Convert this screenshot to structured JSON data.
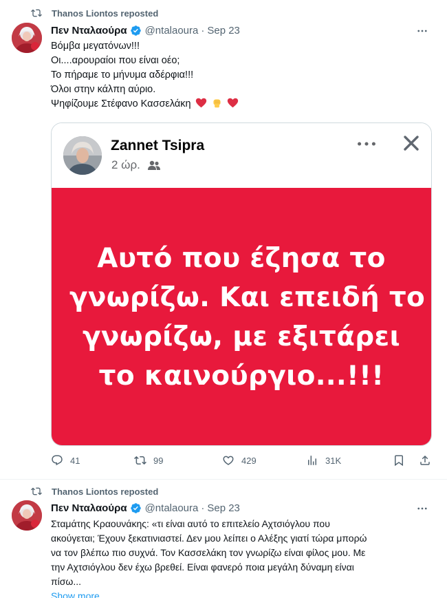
{
  "tweet1": {
    "reposted_by": "Thanos Liontos reposted",
    "author_name": "Πεν Νταλαούρα",
    "handle": "@ntalaoura",
    "separator": "·",
    "date": "Sep 23",
    "text_lines": [
      "Βόμβα μεγατόνων!!!",
      "Οι....αρουραίοι που είναι οέο;",
      "Το πήραμε το μήνυμα αδέρφια!!!",
      "Όλοι στην κάλπη αύριο.",
      "Ψηφίζουμε Στέφανο Κασσελάκη"
    ],
    "emojis": [
      "red-heart",
      "raised-fist",
      "red-heart"
    ],
    "card": {
      "poster_name": "Zannet Tsipra",
      "time_ago": "2 ώρ.",
      "quote_lines": [
        "Αυτό που έζησα το",
        "γνωρίζω. Και επειδή το",
        "γνωρίζω, με εξιτάρει",
        "το καινούργιο...!!!"
      ],
      "banner_color": "#e8193c"
    },
    "actions": {
      "replies": "41",
      "reposts": "99",
      "likes": "429",
      "views": "31K"
    }
  },
  "tweet2": {
    "reposted_by": "Thanos Liontos reposted",
    "author_name": "Πεν Νταλαούρα",
    "handle": "@ntalaoura",
    "separator": "·",
    "date": "Sep 23",
    "text_lines": [
      "Σταμάτης Κραουνάκης: «τι είναι αυτό το επιτελείο Αχτσιόγλου που",
      "ακούγεται; Έχουν ξεκατινιαστεί. Δεν μου λείπει ο Αλέξης γιατί τώρα μπορώ",
      "να τον βλέπω πιο συχνά. Τον Κασσελάκη τον γνωρίζω είναι φίλος μου. Με",
      "την Αχτσιόγλου δεν έχω βρεθεί. Είναι φανερό ποια μεγάλη δύναμη είναι",
      "πίσω..."
    ],
    "show_more": "Show more"
  },
  "colors": {
    "text_primary": "#0f1419",
    "text_secondary": "#536471",
    "verified_blue": "#1d9bf0",
    "link_blue": "#1d9bf0"
  },
  "icons": [
    "repost-icon",
    "verified-icon",
    "more-icon",
    "reply-icon",
    "like-icon",
    "views-icon",
    "bookmark-icon",
    "share-icon",
    "close-icon",
    "audience-icon"
  ]
}
